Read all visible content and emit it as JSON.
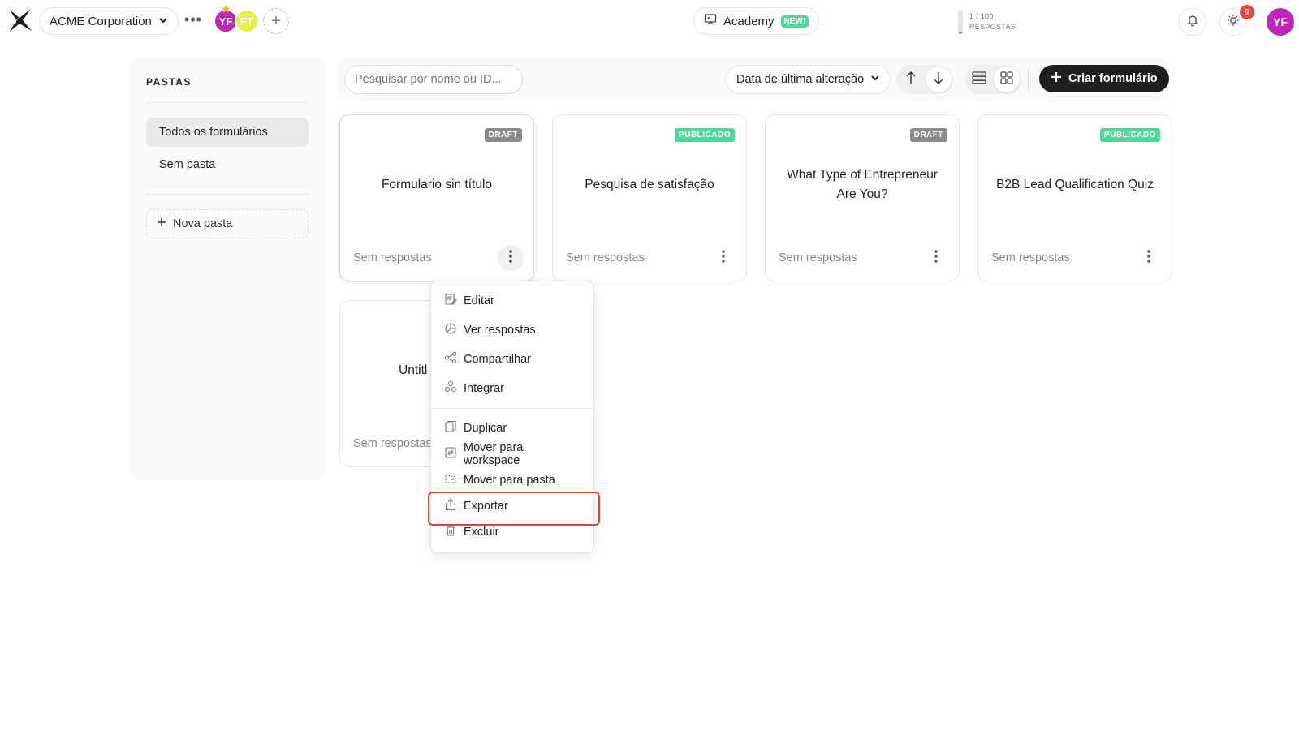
{
  "topbar": {
    "workspace": "ACME Corporation",
    "more_label": "•••",
    "members": [
      "YF",
      "FT"
    ],
    "academy_label": "Academy",
    "academy_badge": "NEW!",
    "responses_count": "1 / 100",
    "responses_label": "RESPOSTAS",
    "responses_used_fraction": 0.01,
    "notifications_count": "9",
    "user_initials": "YF"
  },
  "sidebar": {
    "title": "PASTAS",
    "items": [
      {
        "label": "Todos os formulários",
        "active": true
      },
      {
        "label": "Sem pasta",
        "active": false
      }
    ],
    "new_folder": "Nova pasta"
  },
  "toolbar": {
    "search_placeholder": "Pesquisar por nome ou ID...",
    "sort_label": "Data de última alteração",
    "create_label": "Criar formulário"
  },
  "cards": [
    {
      "title": "Formulario sin título",
      "badge": "DRAFT",
      "footer": "Sem respostas"
    },
    {
      "title": "Pesquisa de satisfação",
      "badge": "PUBLICADO",
      "footer": "Sem respostas"
    },
    {
      "title": "What Type of Entrepreneur Are You?",
      "badge": "DRAFT",
      "footer": "Sem respostas"
    },
    {
      "title": "B2B Lead Qualification Quiz",
      "badge": "PUBLICADO",
      "footer": "Sem respostas"
    },
    {
      "title": "Untitl",
      "badge": "",
      "footer": "Sem respostas"
    }
  ],
  "menu": {
    "items": [
      "Editar",
      "Ver respostas",
      "Compartilhar",
      "Integrar",
      "Duplicar",
      "Mover para workspace",
      "Mover para pasta",
      "Exportar",
      "Excluir"
    ],
    "highlighted": "Exportar"
  },
  "colors": {
    "accent_purple": "#c026b5",
    "published_green": "#4ed89a",
    "draft_gray": "#8c8c8c",
    "highlight_red": "#e0442d",
    "dark_button": "#1f1f1f"
  }
}
